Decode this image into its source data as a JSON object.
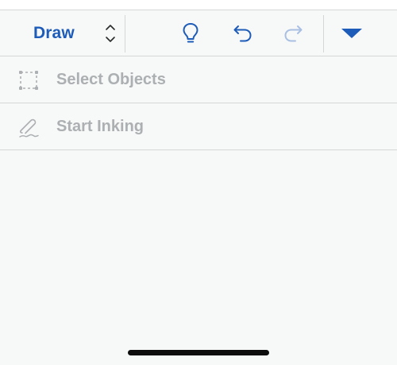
{
  "toolbar": {
    "tab_label": "Draw",
    "tab_picker_icon": "up-down-chevron-icon",
    "buttons": [
      {
        "name": "tell-me-button",
        "icon": "lightbulb-icon"
      },
      {
        "name": "undo-button",
        "icon": "undo-icon"
      },
      {
        "name": "redo-button",
        "icon": "redo-icon",
        "enabled": false
      },
      {
        "name": "collapse-ribbon-button",
        "icon": "caret-down-icon"
      }
    ]
  },
  "menu": {
    "items": [
      {
        "label": "Select Objects",
        "icon": "selection-box-icon",
        "enabled": false
      },
      {
        "label": "Start Inking",
        "icon": "ink-pen-icon",
        "enabled": false
      }
    ]
  },
  "colors": {
    "accent": "#1d5cb9",
    "disabled_text": "#adb0b2",
    "disabled_icon_blue": "#a9c0e3",
    "background": "#f7f8f8",
    "divider": "#d5d6d7"
  }
}
